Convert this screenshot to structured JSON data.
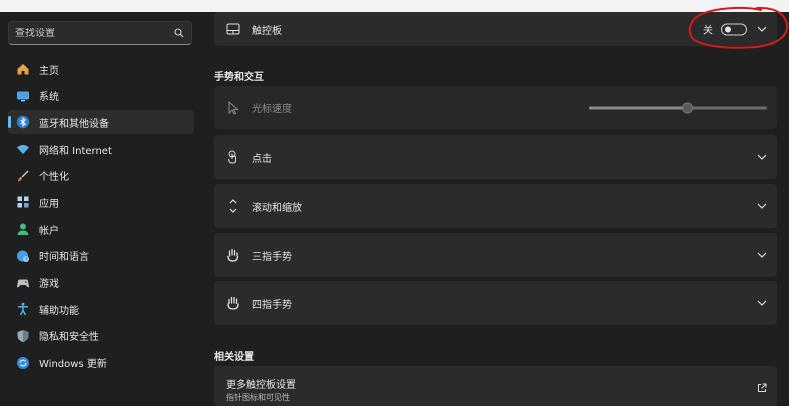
{
  "sidebar": {
    "search_placeholder": "查找设置",
    "items": [
      {
        "label": "主页",
        "icon": "home-icon"
      },
      {
        "label": "系统",
        "icon": "monitor-icon"
      },
      {
        "label": "蓝牙和其他设备",
        "icon": "bluetooth-icon",
        "active": true
      },
      {
        "label": "网络和 Internet",
        "icon": "wifi-icon"
      },
      {
        "label": "个性化",
        "icon": "brush-icon"
      },
      {
        "label": "应用",
        "icon": "apps-icon"
      },
      {
        "label": "帐户",
        "icon": "person-icon"
      },
      {
        "label": "时间和语言",
        "icon": "globe-clock-icon"
      },
      {
        "label": "游戏",
        "icon": "gamepad-icon"
      },
      {
        "label": "辅助功能",
        "icon": "accessibility-icon"
      },
      {
        "label": "隐私和安全性",
        "icon": "shield-icon"
      },
      {
        "label": "Windows 更新",
        "icon": "sync-icon"
      }
    ]
  },
  "main": {
    "touchpad": {
      "label": "触控板",
      "toggle_label": "关",
      "toggle_on": false
    },
    "gestures_section": "手势和交互",
    "cursor_speed": {
      "label": "光标速度",
      "value_fraction": 0.55
    },
    "cards": [
      {
        "label": "点击",
        "icon": "tap-icon"
      },
      {
        "label": "滚动和缩放",
        "icon": "scroll-icon"
      },
      {
        "label": "三指手势",
        "icon": "three-finger-icon"
      },
      {
        "label": "四指手势",
        "icon": "four-finger-icon"
      }
    ],
    "related_section": "相关设置",
    "related": {
      "title": "更多触控板设置",
      "subtitle": "指针图标和可见性"
    }
  },
  "colors": {
    "accent": "#4cc2ff",
    "annotation": "#d01c1c",
    "card": "#2b2b2b",
    "background": "#1f1f1f"
  }
}
